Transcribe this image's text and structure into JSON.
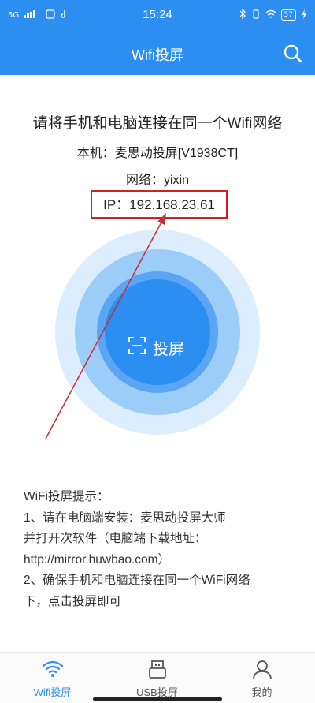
{
  "status_bar": {
    "signal_left": "5G",
    "time": "15:24",
    "battery": "57"
  },
  "header": {
    "title": "Wifi投屏"
  },
  "connection": {
    "instruction": "请将手机和电脑连接在同一个Wifi网络",
    "device_line": "本机：麦思动投屏[V1938CT]",
    "network_line": "网络：yixin",
    "ip_line": "IP：192.168.23.61"
  },
  "cast_button": {
    "label": "投屏"
  },
  "tips": {
    "title": "WiFi投屏提示：",
    "line1": "1、请在电脑端安装：麦思动投屏大师",
    "line2": "并打开次软件（电脑端下载地址：",
    "line3": "http://mirror.huwbao.com）",
    "line4": "2、确保手机和电脑连接在同一个WiFi网络",
    "line5": "下，点击投屏即可"
  },
  "tabs": [
    {
      "label": "Wifi投屏",
      "icon": "wifi-icon",
      "active": true
    },
    {
      "label": "USB投屏",
      "icon": "usb-icon",
      "active": false
    },
    {
      "label": "我的",
      "icon": "user-icon",
      "active": false
    }
  ],
  "colors": {
    "primary": "#2b8ef0",
    "highlight_box": "#d02020",
    "arrow": "#c0303a"
  }
}
